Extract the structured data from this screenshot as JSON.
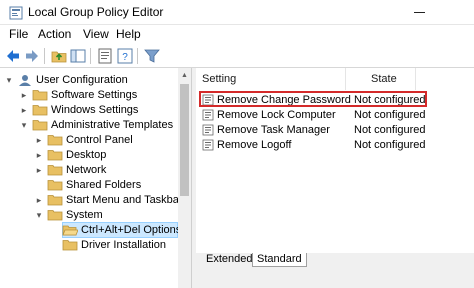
{
  "window": {
    "title": "Local Group Policy Editor"
  },
  "menu": [
    "File",
    "Action",
    "View",
    "Help"
  ],
  "toolbar": [
    "back-icon",
    "forward-icon",
    "up-folder-icon",
    "show-hide-tree-icon",
    "properties-icon",
    "help-icon",
    "filter-icon"
  ],
  "tree": [
    {
      "label": "User Configuration",
      "expanded": true,
      "icon": "computer-user-icon"
    },
    {
      "label": "Software Settings",
      "expanded": false,
      "icon": "folder-icon"
    },
    {
      "label": "Windows Settings",
      "expanded": false,
      "icon": "folder-icon"
    },
    {
      "label": "Administrative Templates",
      "expanded": true,
      "icon": "folder-icon"
    },
    {
      "label": "Control Panel",
      "expanded": false,
      "icon": "folder-icon"
    },
    {
      "label": "Desktop",
      "expanded": false,
      "icon": "folder-icon"
    },
    {
      "label": "Network",
      "expanded": false,
      "icon": "folder-icon"
    },
    {
      "label": "Shared Folders",
      "expanded": null,
      "icon": "folder-icon"
    },
    {
      "label": "Start Menu and Taskbar",
      "expanded": false,
      "icon": "folder-icon"
    },
    {
      "label": "System",
      "expanded": true,
      "icon": "folder-icon"
    },
    {
      "label": "Ctrl+Alt+Del Options",
      "expanded": null,
      "icon": "open-folder-icon",
      "selected": true
    },
    {
      "label": "Driver Installation",
      "expanded": null,
      "icon": "folder-icon"
    }
  ],
  "list": {
    "columns": [
      "Setting",
      "State"
    ],
    "rows": [
      {
        "setting": "Remove Change Password",
        "state": "Not configured",
        "highlighted": true
      },
      {
        "setting": "Remove Lock Computer",
        "state": "Not configured"
      },
      {
        "setting": "Remove Task Manager",
        "state": "Not configured"
      },
      {
        "setting": "Remove Logoff",
        "state": "Not configured"
      }
    ]
  },
  "tabs": [
    "Extended",
    "Standard"
  ],
  "active_tab": "Standard",
  "colors": {
    "selection": "#cce8ff",
    "highlight_border": "#d42a2a",
    "folder": "#e8c063"
  }
}
